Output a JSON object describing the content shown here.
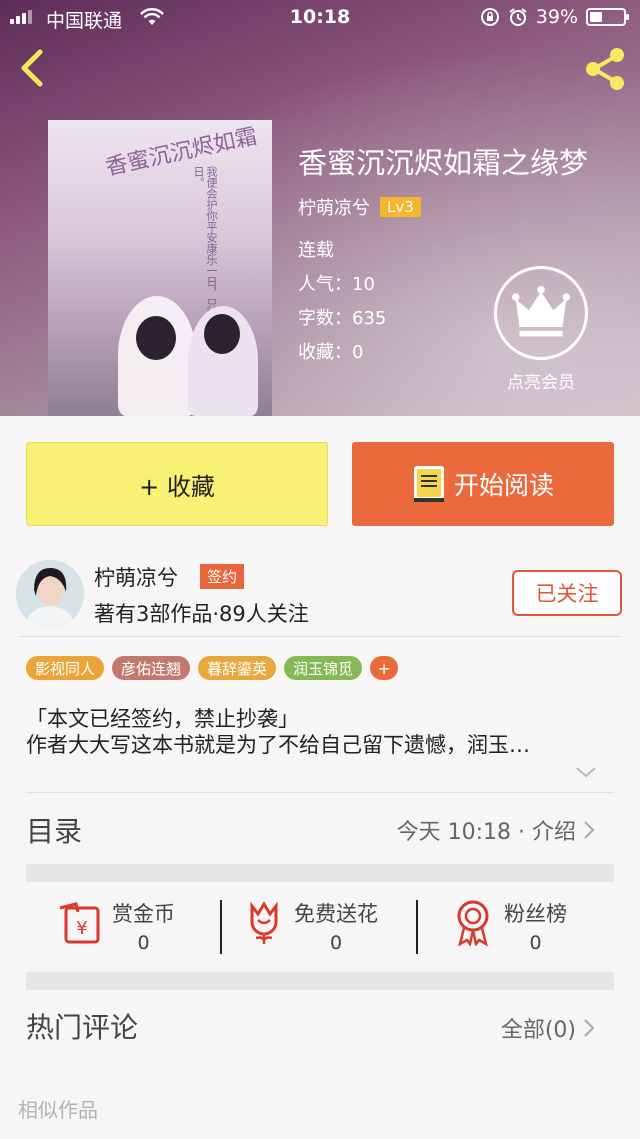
{
  "status_bar": {
    "carrier": "中国联通",
    "time": "10:18",
    "battery": "39%",
    "battery_level": 0.39
  },
  "book": {
    "title": "香蜜沉沉烬如霜之缘梦",
    "author": "柠萌凉兮",
    "level": "Lv3",
    "status": "连载",
    "popularity": "人气：10",
    "word_count": "字数：635",
    "favorites": "收藏：0",
    "vip_label": "点亮会员",
    "cover_title": "香蜜沉沉烬如霜",
    "cover_poem": "我便会护你平安康乐一日，只要有我在你身边一日。"
  },
  "buttons": {
    "favorite": "+ 收藏",
    "read": "开始阅读"
  },
  "author_info": {
    "name": "柠萌凉兮",
    "badge": "签约",
    "stats": "著有3部作品·89人关注",
    "follow": "已关注"
  },
  "tags": [
    {
      "label": "影视同人",
      "color": "#e9a43a"
    },
    {
      "label": "彦佑连翘",
      "color": "#c27a6e"
    },
    {
      "label": "暮辞鎏英",
      "color": "#e6a93d"
    },
    {
      "label": "润玉锦觅",
      "color": "#86b955"
    }
  ],
  "tag_more": "+",
  "intro": {
    "line1": "「本文已经签约，禁止抄袭」",
    "line2": "作者大大写这本书就是为了不给自己留下遗憾，润玉…"
  },
  "toc": {
    "label": "目录",
    "update": "今天 10:18 · 介绍"
  },
  "actions": [
    {
      "label": "赏金币",
      "count": "0",
      "icon": "red-envelope-icon"
    },
    {
      "label": "免费送花",
      "count": "0",
      "icon": "flower-icon"
    },
    {
      "label": "粉丝榜",
      "count": "0",
      "icon": "medal-icon"
    }
  ],
  "comments": {
    "label": "热门评论",
    "all": "全部(0)"
  },
  "similar": {
    "label": "相似作品"
  },
  "colors": {
    "accent": "#eb6a3d",
    "fav_button": "#f9f176",
    "level_badge": "#f5b62b"
  }
}
